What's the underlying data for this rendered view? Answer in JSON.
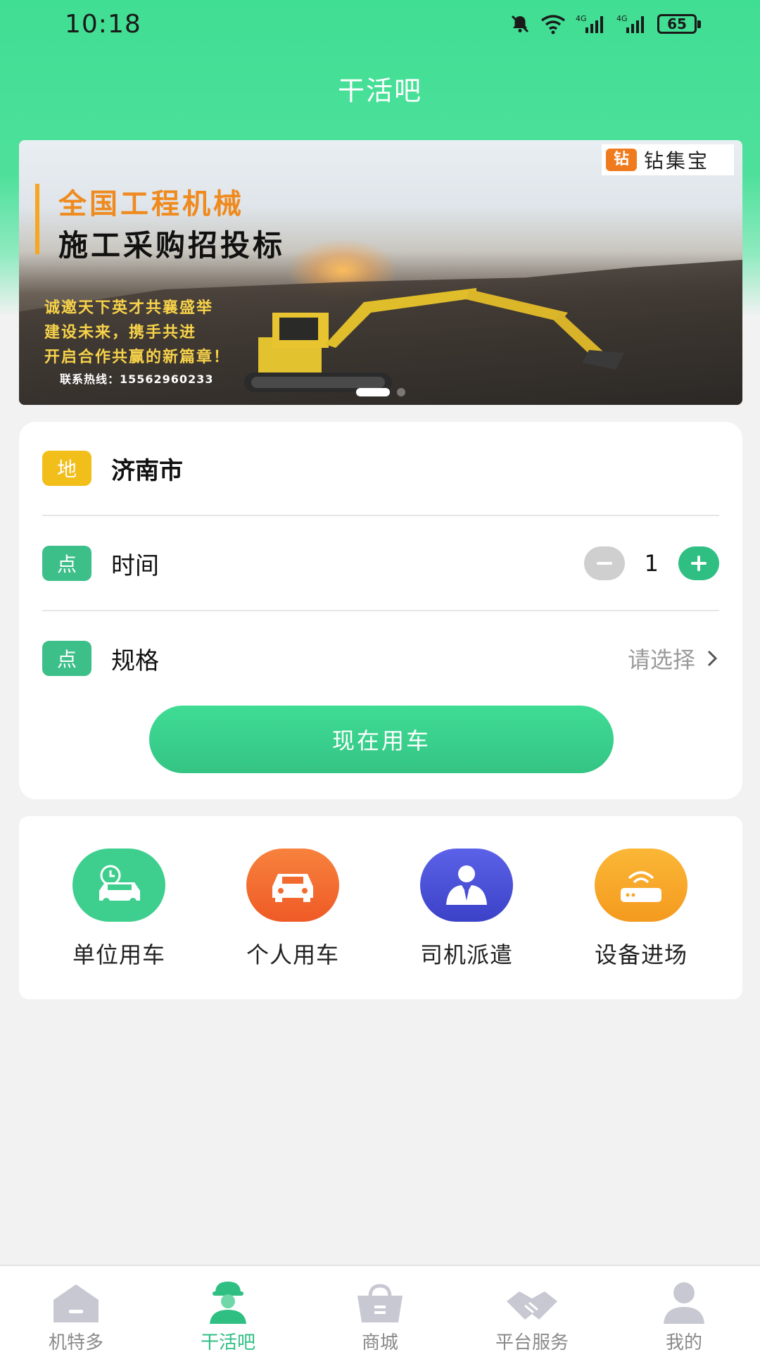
{
  "status_bar": {
    "time": "10:18",
    "battery": "65",
    "network_1": "4G",
    "network_2": "4G"
  },
  "header": {
    "title": "干活吧"
  },
  "banner": {
    "logo_mark": "钻",
    "logo_text": "钻集宝",
    "headline": "全国工程机械",
    "subheadline": "施工采购招投标",
    "lines": [
      "诚邀天下英才共襄盛举",
      "建设未来，携手共进",
      "开启合作共赢的新篇章！"
    ],
    "hotline": "联系热线：15562960233",
    "page_count": 2,
    "active_page": 0
  },
  "order": {
    "location": {
      "tag": "地",
      "value": "济南市"
    },
    "time": {
      "tag": "点",
      "label": "时间",
      "quantity": "1"
    },
    "spec": {
      "tag": "点",
      "label": "规格",
      "placeholder": "请选择"
    },
    "submit_label": "现在用车"
  },
  "services": [
    {
      "label": "单位用车",
      "icon": "company-car-icon",
      "color": "#3ecf8e"
    },
    {
      "label": "个人用车",
      "icon": "personal-car-icon",
      "color": "#f36a2e"
    },
    {
      "label": "司机派遣",
      "icon": "driver-icon",
      "color": "#4a4fd6"
    },
    {
      "label": "设备进场",
      "icon": "equipment-icon",
      "color": "#f7a82a"
    }
  ],
  "tabbar": [
    {
      "label": "机特多",
      "icon": "home-icon",
      "active": false
    },
    {
      "label": "干活吧",
      "icon": "worker-icon",
      "active": true
    },
    {
      "label": "商城",
      "icon": "shop-basket-icon",
      "active": false
    },
    {
      "label": "平台服务",
      "icon": "handshake-icon",
      "active": false
    },
    {
      "label": "我的",
      "icon": "profile-icon",
      "active": false
    }
  ],
  "colors": {
    "brand_green": "#3ddc92",
    "accent_green": "#2fbf83",
    "tag_yellow": "#f2be1a"
  }
}
